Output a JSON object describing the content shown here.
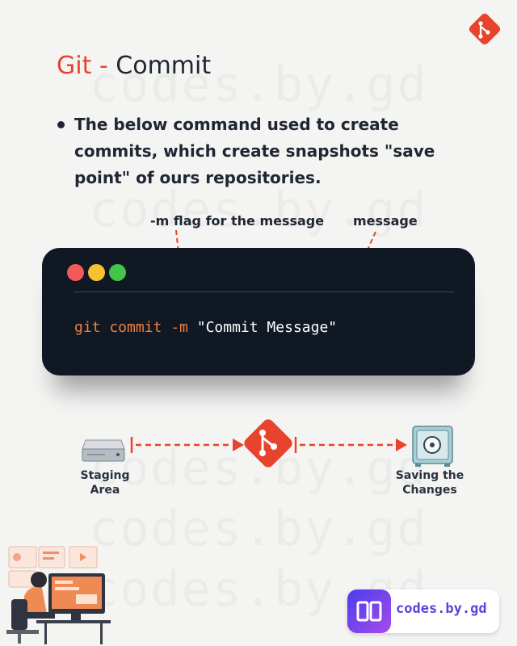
{
  "watermark": "codes.by.gd",
  "title": {
    "accent": "Git -",
    "main": "Commit"
  },
  "bullet": "The below command used to create commits, which create snapshots \"save point\" of ours repositories.",
  "annotations": {
    "flag": "-m flag for the message",
    "message": "message"
  },
  "terminal": {
    "dot_colors": [
      "#f25a5a",
      "#f7c231",
      "#43c44b"
    ],
    "code_keyword": "git commit -m",
    "code_string": "\"Commit Message\""
  },
  "flow": {
    "left_label": "Staging Area",
    "right_label_line1": "Saving the",
    "right_label_line2": "Changes"
  },
  "brand": {
    "text": "codes.by.gd"
  },
  "colors": {
    "accent": "#e8432d",
    "code_keyword": "#f0803c",
    "terminal_bg": "#101823"
  },
  "icons": [
    "git-logo-icon",
    "hard-drive-icon",
    "safe-vault-icon",
    "developer-illustration",
    "brand-logo-icon"
  ]
}
